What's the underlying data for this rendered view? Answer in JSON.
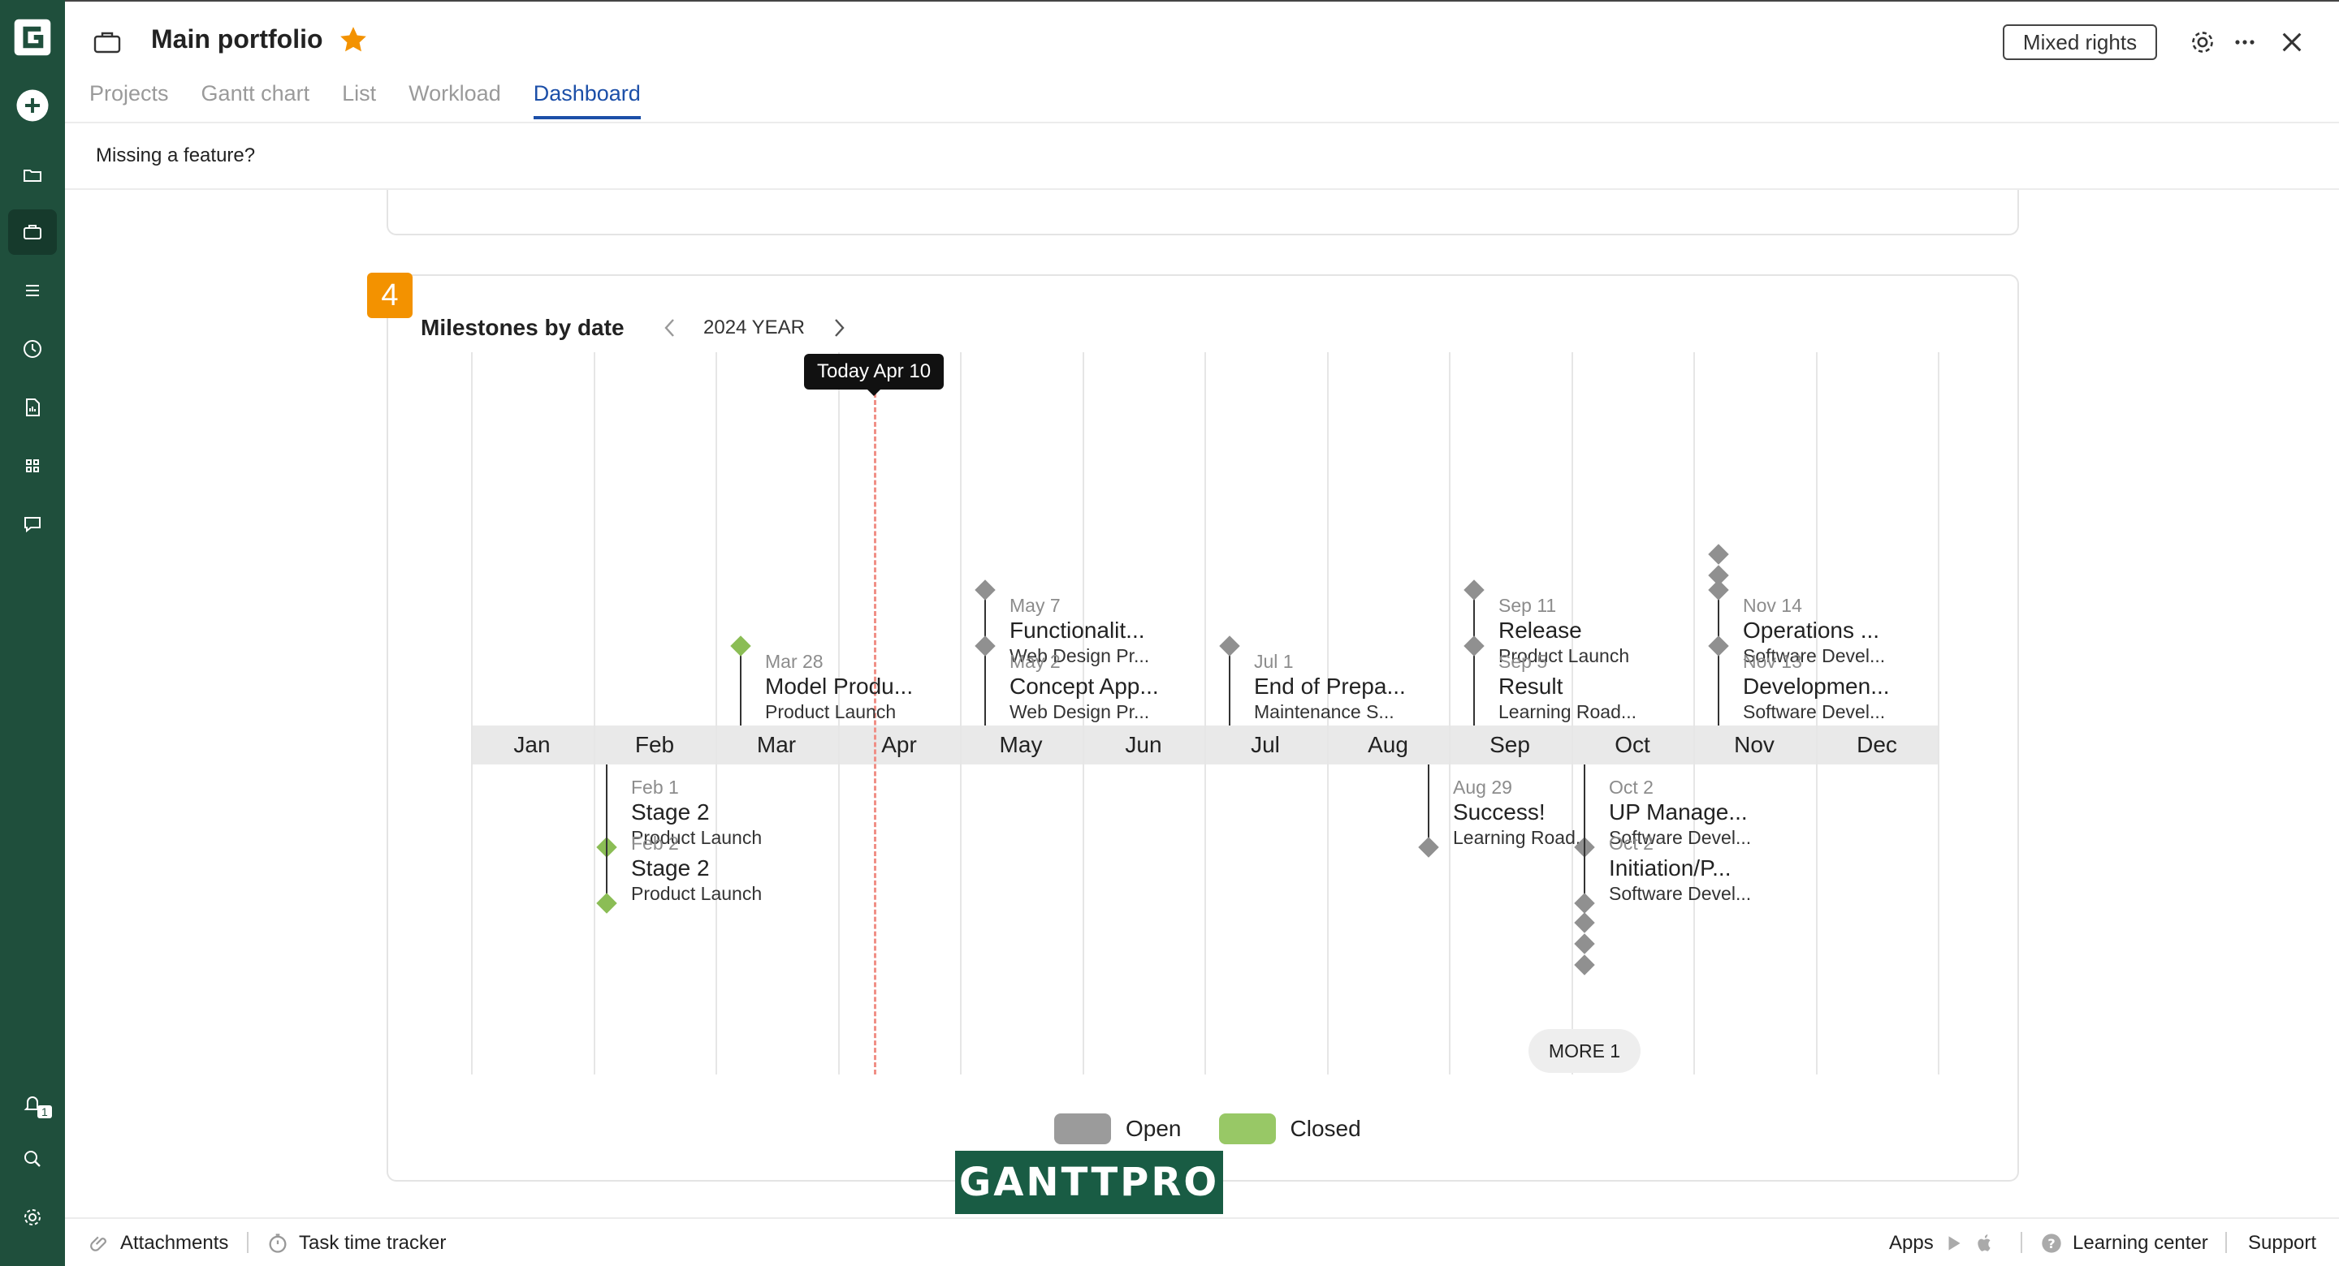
{
  "header": {
    "title": "Main portfolio",
    "rights_label": "Mixed rights"
  },
  "tabs": [
    {
      "label": "Projects",
      "active": false
    },
    {
      "label": "Gantt chart",
      "active": false
    },
    {
      "label": "List",
      "active": false
    },
    {
      "label": "Workload",
      "active": false
    },
    {
      "label": "Dashboard",
      "active": true
    }
  ],
  "notice": "Missing a feature?",
  "rail": {
    "notification_count": "1",
    "icons": [
      "logo-icon",
      "add-icon",
      "folder-icon",
      "briefcase-icon",
      "list-icon",
      "clock-icon",
      "report-icon",
      "grid-icon",
      "chat-icon",
      "bell-icon",
      "search-icon",
      "gear-icon"
    ]
  },
  "widget": {
    "index": "4",
    "title": "Milestones by date",
    "year": "2024 YEAR",
    "today_label": "Today Apr 10",
    "months": [
      "Jan",
      "Feb",
      "Mar",
      "Apr",
      "May",
      "Jun",
      "Jul",
      "Aug",
      "Sep",
      "Oct",
      "Nov",
      "Dec"
    ],
    "milestones_above": [
      {
        "date": "Mar 28",
        "name": "Model Produ...",
        "project": "Product Launch",
        "status": "closed"
      },
      {
        "date": "May 7",
        "name": "Functionalit...",
        "project": "Web Design Pr...",
        "status": "open"
      },
      {
        "date": "May 2",
        "name": "Concept App...",
        "project": "Web Design Pr...",
        "status": "open"
      },
      {
        "date": "Jul 1",
        "name": "End of Prepa...",
        "project": "Maintenance S...",
        "status": "open"
      },
      {
        "date": "Sep 11",
        "name": "Release",
        "project": "Product Launch",
        "status": "open"
      },
      {
        "date": "Sep 5",
        "name": "Result",
        "project": "Learning Road...",
        "status": "open"
      },
      {
        "date": "Nov 14",
        "name": "Operations ...",
        "project": "Software Devel...",
        "status": "open"
      },
      {
        "date": "Nov 13",
        "name": "Developmen...",
        "project": "Software Devel...",
        "status": "open"
      }
    ],
    "milestones_below": [
      {
        "date": "Feb 1",
        "name": "Stage 2",
        "project": "Product Launch",
        "status": "closed"
      },
      {
        "date": "Feb 2",
        "name": "Stage 2",
        "project": "Product Launch",
        "status": "closed"
      },
      {
        "date": "Aug 29",
        "name": "Success!",
        "project": "Learning Road...",
        "status": "open"
      },
      {
        "date": "Oct 2",
        "name": "UP Manage...",
        "project": "Software Devel...",
        "status": "open"
      },
      {
        "date": "Oct 2",
        "name": "Initiation/P...",
        "project": "Software Devel...",
        "status": "open"
      }
    ],
    "more_label": "MORE 1",
    "legend": {
      "open": "Open",
      "closed": "Closed"
    },
    "colors": {
      "open": "#909090",
      "closed": "#8bbd55",
      "today": "#f08f86",
      "badge": "#f39200"
    }
  },
  "watermark": "GANTTPRO",
  "footer": {
    "attachments": "Attachments",
    "time_tracker": "Task time tracker",
    "apps": "Apps",
    "learning": "Learning center",
    "support": "Support"
  }
}
